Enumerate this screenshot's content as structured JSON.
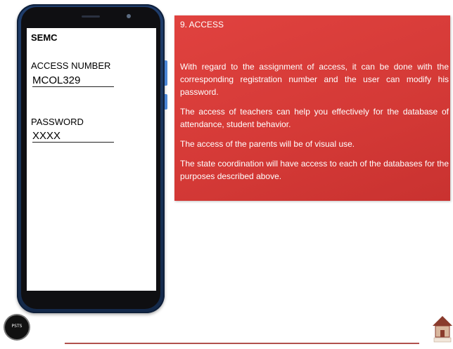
{
  "phone": {
    "app_title": "SEMC",
    "access_label": "ACCESS NUMBER",
    "access_value": "MCOL329",
    "password_label": "PASSWORD",
    "password_value": "XXXX"
  },
  "panel": {
    "heading": "9. ACCESS",
    "paragraphs": [
      "With regard to the assignment of access, it can be done with the corresponding registration number and the user can modify his password.",
      "The access of teachers can help you effectively for the database of attendance, student behavior.",
      "The access of the parents will be of visual use.",
      "The state coordination will have access to each of the databases for the purposes described above."
    ]
  },
  "footer": {
    "left_logo_text": "PSTS"
  },
  "colors": {
    "panel_red": "#d53a37",
    "phone_blue": "#1f3d6b",
    "footer_line": "#b1514d"
  },
  "icons": {
    "left_logo": "circular-seal-logo",
    "right_logo": "house-logo"
  }
}
